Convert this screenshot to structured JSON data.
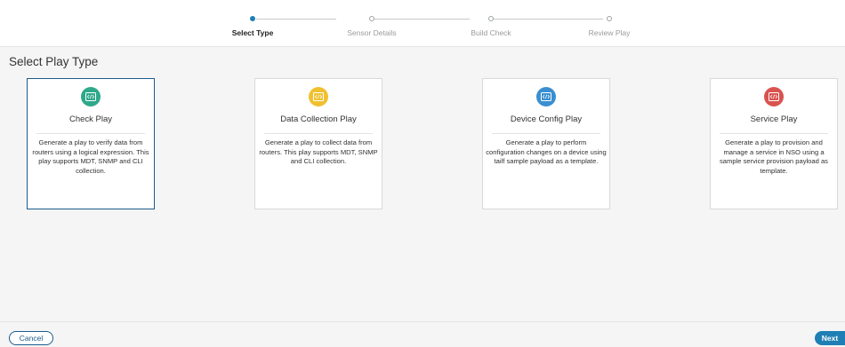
{
  "wizard": {
    "steps": [
      {
        "label": "Select Type",
        "active": true
      },
      {
        "label": "Sensor Details",
        "active": false
      },
      {
        "label": "Build Check",
        "active": false
      },
      {
        "label": "Review Play",
        "active": false
      }
    ]
  },
  "page": {
    "title": "Select Play Type"
  },
  "cards": [
    {
      "title": "Check Play",
      "icon": "code-icon",
      "color": "#2fa88a",
      "selected": true,
      "description": "Generate a play to verify data from routers using a logical expression. This play supports MDT, SNMP and CLI collection."
    },
    {
      "title": "Data Collection Play",
      "icon": "code-icon",
      "color": "#f0c02f",
      "selected": false,
      "description": "Generate a play to collect data from routers. This play supports MDT, SNMP and CLI collection."
    },
    {
      "title": "Device Config Play",
      "icon": "code-icon",
      "color": "#3a8fd0",
      "selected": false,
      "description": "Generate a play to perform configuration changes on a device using tailf sample payload as a template."
    },
    {
      "title": "Service Play",
      "icon": "code-icon",
      "color": "#d9534f",
      "selected": false,
      "description": "Generate a play to provision and manage a service in NSO using a sample service provision payload as template."
    }
  ],
  "footer": {
    "cancel_label": "Cancel",
    "next_label": "Next"
  },
  "colors": {
    "accent": "#1f7fb4",
    "selected_border": "#1b5c8c"
  }
}
